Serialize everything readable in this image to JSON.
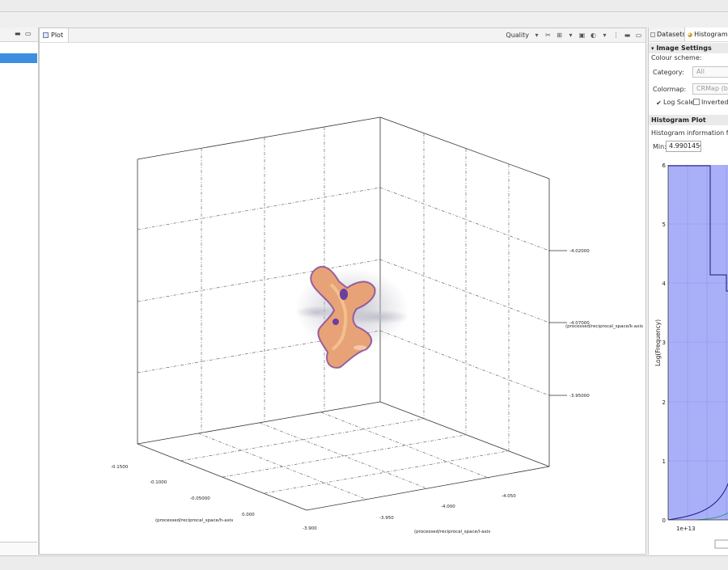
{
  "plot_view": {
    "tab_label": "Plot",
    "toolbar": {
      "quality_label": "Quality"
    },
    "axes": {
      "x_label": "(processed/reciprocal_space/h-axis",
      "y_label": "(processed/reciprocal_space/l-axis",
      "z_label": "(processed/reciprocal_space/k-axis",
      "x_ticks": [
        "-0.1500",
        "-0.1000",
        "-0.05000",
        "0.000"
      ],
      "y_ticks": [
        "-3.900",
        "-3.950",
        "-4.000",
        "-4.050"
      ],
      "z_ticks": [
        "-4.02000",
        "-4.07000",
        "-3.95000"
      ]
    }
  },
  "right_panel": {
    "tabs": {
      "datasets": "Datasets",
      "histogram": "Histogram"
    },
    "image_settings": {
      "title": "Image Settings",
      "colour_scheme_label": "Colour scheme:",
      "category_label": "Category:",
      "category_value": "All",
      "colormap_label": "Colormap:",
      "colormap_value": "CRMap (blac",
      "log_scale_label": "Log Scale",
      "inverted_label": "Inverted"
    },
    "histogram": {
      "title": "Histogram Plot",
      "info": "Histogram information for ac",
      "min_label": "Min:",
      "min_value": "4.990145€",
      "ylabel": "Log(Frequency)",
      "y_ticks": [
        "6",
        "5",
        "4",
        "3",
        "2",
        "1",
        "0"
      ],
      "x_exponent": "1e+13"
    }
  },
  "colors": {
    "selection": "#3d8ee0",
    "histogram_fill": "#aab0f8",
    "isosurface": "#e8a277"
  }
}
